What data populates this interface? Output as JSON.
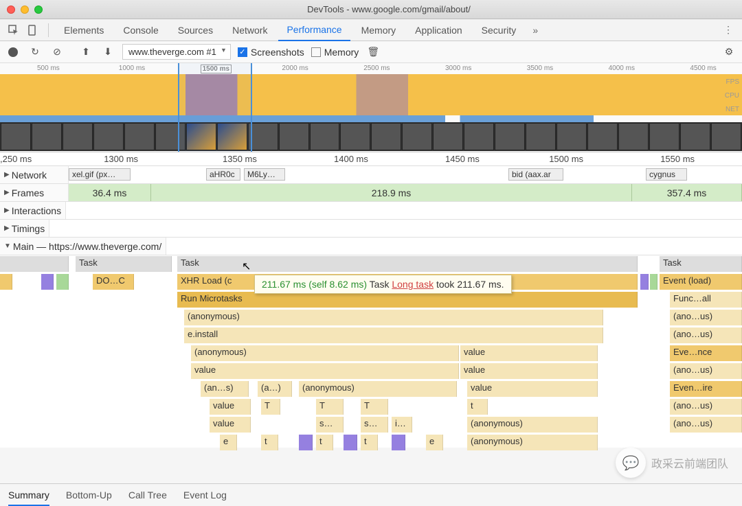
{
  "title": "DevTools - www.google.com/gmail/about/",
  "tabs": [
    "Elements",
    "Console",
    "Sources",
    "Network",
    "Performance",
    "Memory",
    "Application",
    "Security"
  ],
  "activeTab": "Performance",
  "recording": {
    "select": "www.theverge.com #1",
    "screenshots": "Screenshots",
    "memory": "Memory"
  },
  "overview": {
    "ticks": [
      "500 ms",
      "1000 ms",
      "1500 ms",
      "2000 ms",
      "2500 ms",
      "3000 ms",
      "3500 ms",
      "4000 ms",
      "4500 ms"
    ],
    "labels": [
      "FPS",
      "CPU",
      "NET"
    ]
  },
  "detailTicks": [
    ",250 ms",
    "1300 ms",
    "1350 ms",
    "1400 ms",
    "1450 ms",
    "1500 ms",
    "1550 ms"
  ],
  "tracks": {
    "network": "Network",
    "networkItems": [
      "xel.gif (px…",
      "aHR0c",
      "M6Ly…",
      "bid (aax.ar",
      "cygnus"
    ],
    "frames": "Frames",
    "frameTimes": [
      "36.4 ms",
      "218.9 ms",
      "357.4 ms"
    ],
    "interactions": "Interactions",
    "timings": "Timings",
    "main": "Main — https://www.theverge.com/"
  },
  "flame": {
    "task": "Task",
    "xhr": "XHR Load (c",
    "doc": "DO…C",
    "micro": "Run Microtasks",
    "anon": "(anonymous)",
    "install": "e.install",
    "value": "value",
    "ans": "(an…s)",
    "a": "(a…)",
    "t": "t",
    "T": "T",
    "s": "s…",
    "i": "i…",
    "e": "e",
    "event": "Event (load)",
    "func": "Func…all",
    "anous": "(ano…us)",
    "evence": "Eve…nce",
    "evenire": "Even…ire"
  },
  "tooltip": {
    "time": "211.67 ms (self 8.62 ms)",
    "task": "Task",
    "long": "Long task",
    "took": "took 211.67 ms."
  },
  "bottomTabs": [
    "Summary",
    "Bottom-Up",
    "Call Tree",
    "Event Log"
  ],
  "watermark": "政采云前端团队"
}
